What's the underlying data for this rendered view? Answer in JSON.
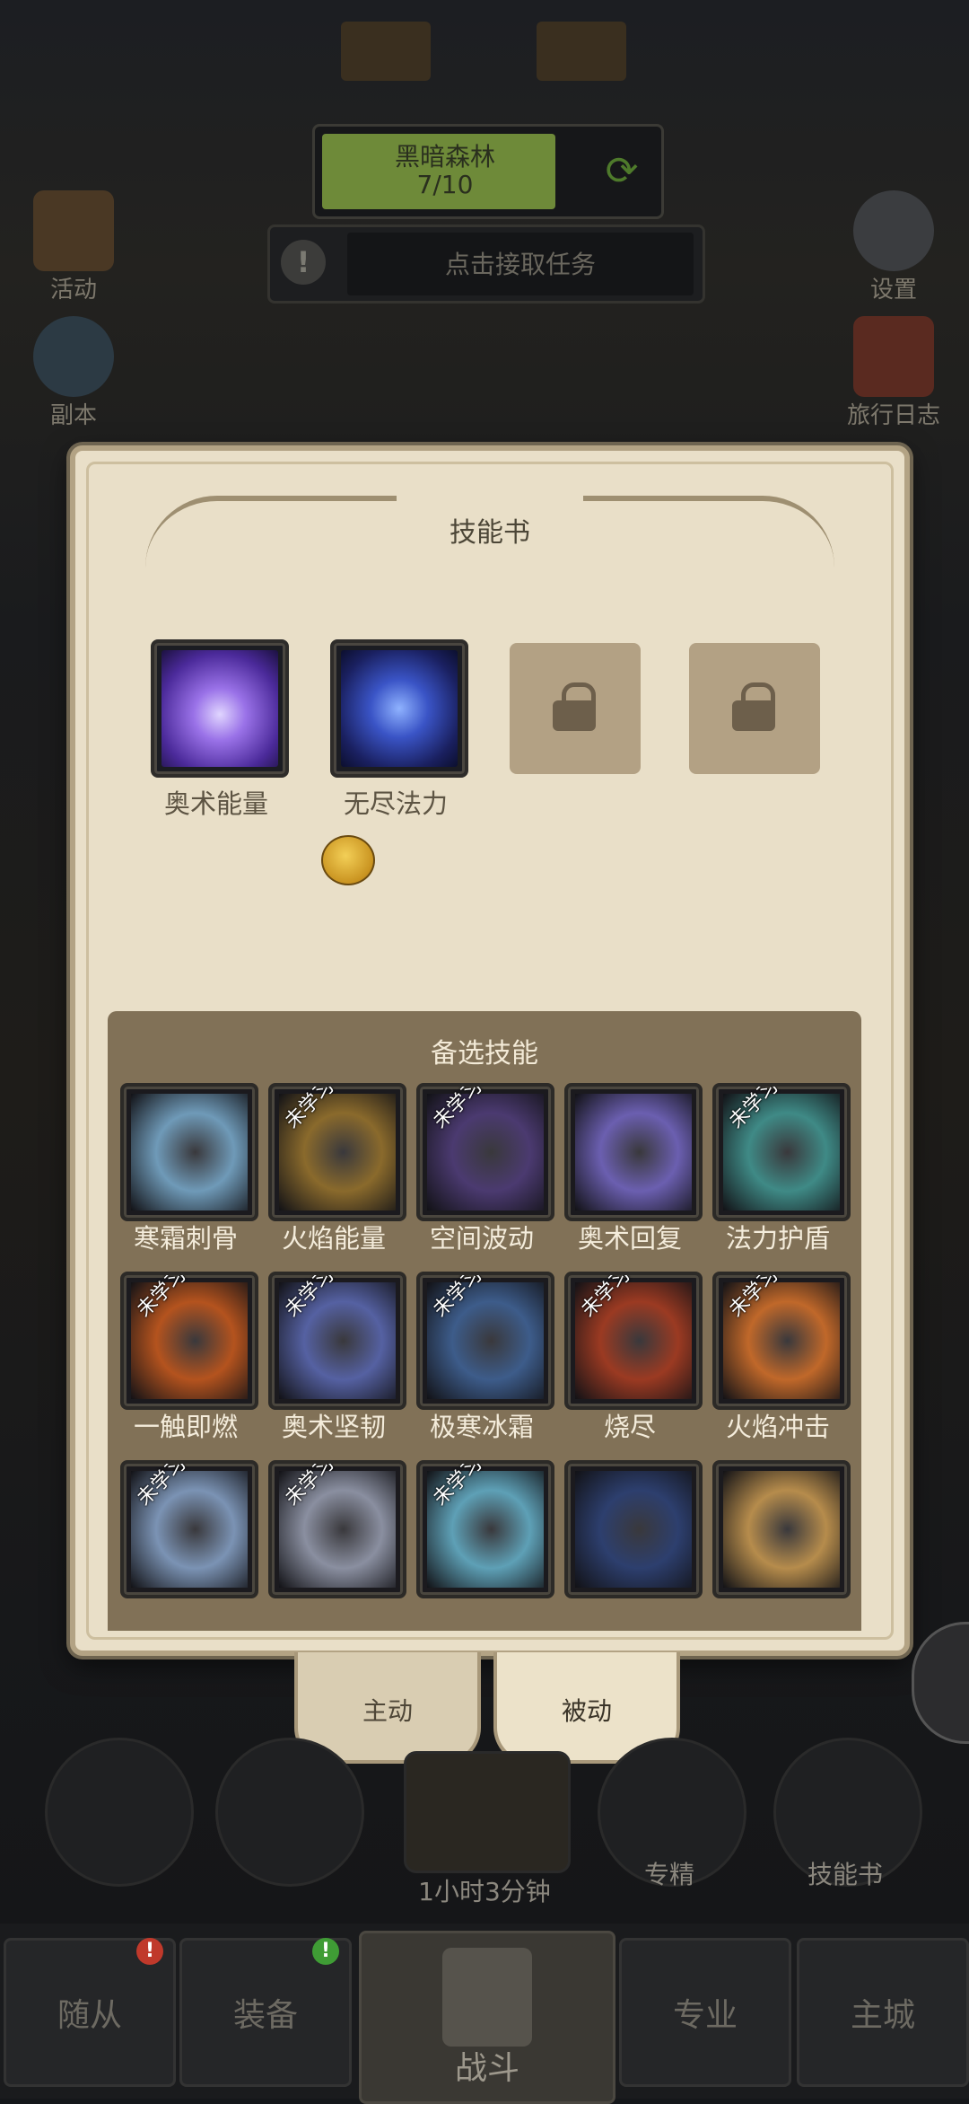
{
  "hud": {
    "zone_name": "黑暗森林",
    "zone_progress": "7/10",
    "quest_text": "点击接取任务",
    "left_buttons": [
      "活动",
      "副本"
    ],
    "right_buttons": [
      "设置",
      "旅行日志"
    ]
  },
  "modal": {
    "title": "技能书",
    "equipped": [
      {
        "label": "奥术能量",
        "locked": false,
        "color": "#6a3fb8"
      },
      {
        "label": "无尽法力",
        "locked": false,
        "color": "#2a3a8c"
      },
      {
        "label": "",
        "locked": true
      },
      {
        "label": "",
        "locked": true
      }
    ],
    "alternatives_title": "备选技能",
    "not_learned_badge": "未学习",
    "skills": [
      {
        "label": "寒霜刺骨",
        "learned": true,
        "color": "#6f9ab8"
      },
      {
        "label": "火焰能量",
        "learned": false,
        "color": "#8a6a2c"
      },
      {
        "label": "空间波动",
        "learned": false,
        "color": "#4b3a70"
      },
      {
        "label": "奥术回复",
        "learned": true,
        "color": "#6b5fb0"
      },
      {
        "label": "法力护盾",
        "learned": false,
        "color": "#3f8a86"
      },
      {
        "label": "一触即燃",
        "learned": false,
        "color": "#b4531e"
      },
      {
        "label": "奥术坚韧",
        "learned": false,
        "color": "#5561a2"
      },
      {
        "label": "极寒冰霜",
        "learned": false,
        "color": "#3d5c8a"
      },
      {
        "label": "烧尽",
        "learned": false,
        "color": "#9b3a22"
      },
      {
        "label": "火焰冲击",
        "learned": false,
        "color": "#c0682a"
      },
      {
        "label": "",
        "learned": false,
        "color": "#7b93b4"
      },
      {
        "label": "",
        "learned": false,
        "color": "#8a8fa0"
      },
      {
        "label": "",
        "learned": false,
        "color": "#5ea0b6"
      },
      {
        "label": "",
        "learned": true,
        "color": "#2d3f6e"
      },
      {
        "label": "",
        "learned": true,
        "color": "#b68c4c"
      }
    ],
    "tabs": [
      "主动",
      "被动"
    ],
    "active_tab": "被动"
  },
  "bottom": {
    "circle_labels": [
      "",
      "",
      "",
      "专精",
      "技能书"
    ],
    "timer": "1小时3分钟"
  },
  "nav": {
    "items": [
      "随从",
      "装备",
      "战斗",
      "专业",
      "主城"
    ],
    "badges": {
      "随从": "!",
      "装备": "!"
    }
  }
}
